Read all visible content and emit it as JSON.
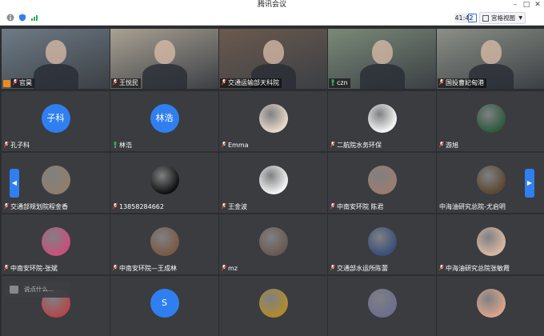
{
  "window": {
    "title": "腾讯会议"
  },
  "toolbar": {
    "timer": "41:42",
    "view_mode": "宫格视图"
  },
  "chat": {
    "placeholder": "说点什么..."
  },
  "participants": [
    {
      "name": "官昊",
      "kind": "video",
      "mic": "muted",
      "bg": "#6e7b86"
    },
    {
      "name": "王悦民",
      "kind": "video",
      "mic": "muted",
      "bg": "#a9a193"
    },
    {
      "name": "交通运输部天科院",
      "kind": "video",
      "mic": "muted",
      "bg": "#6b5a4e"
    },
    {
      "name": "czn",
      "kind": "video",
      "mic": "on",
      "bg": "#7a8a78"
    },
    {
      "name": "国投曹妃甸港",
      "kind": "video",
      "mic": "muted",
      "bg": "#8b8f86"
    },
    {
      "name": "孔子科",
      "kind": "avatar-text",
      "avatar_text": "子科",
      "mic": "muted"
    },
    {
      "name": "林浩",
      "kind": "avatar-text",
      "avatar_text": "林浩",
      "mic": "on"
    },
    {
      "name": "Emma",
      "kind": "avatar-img",
      "mic": "muted",
      "bg": "#e7d9c8"
    },
    {
      "name": "二航院水务环保",
      "kind": "avatar-img",
      "mic": "muted",
      "bg": "#f4f4f4"
    },
    {
      "name": "游旭",
      "kind": "avatar-img",
      "mic": "muted",
      "bg": "#2f5a3e"
    },
    {
      "name": "交通部规划院程金香",
      "kind": "avatar-img",
      "mic": "muted",
      "bg": "#8f7e6a"
    },
    {
      "name": "13858284662",
      "kind": "avatar-img",
      "mic": "muted",
      "bg": "#111111"
    },
    {
      "name": "王金波",
      "kind": "avatar-img",
      "mic": "muted",
      "bg": "#f3f3f3"
    },
    {
      "name": "中南安环院 陈君",
      "kind": "avatar-img",
      "mic": "muted",
      "bg": "#9b7c70"
    },
    {
      "name": "中海油研究总院-尤启明",
      "kind": "avatar-img",
      "mic": "none",
      "bg": "#5b4833"
    },
    {
      "name": "中南安环院-张斌",
      "kind": "avatar-img",
      "mic": "muted",
      "bg": "#c94f7b"
    },
    {
      "name": "中南安环院—王成林",
      "kind": "avatar-img",
      "mic": "muted",
      "bg": "#7a5a44"
    },
    {
      "name": "mz",
      "kind": "avatar-img",
      "mic": "muted",
      "bg": "#6a5a52"
    },
    {
      "name": "交通部水运所陈蕾",
      "kind": "avatar-img",
      "mic": "muted",
      "bg": "#3b4f7a"
    },
    {
      "name": "中海油研究总院张敏霞",
      "kind": "avatar-img",
      "mic": "muted",
      "bg": "#d8b7a2"
    },
    {
      "name": "",
      "kind": "avatar-img",
      "mic": "muted",
      "bg": "#b3484c"
    },
    {
      "name": "",
      "kind": "avatar-text",
      "avatar_text": "S",
      "mic": "muted"
    },
    {
      "name": "",
      "kind": "avatar-img",
      "mic": "muted",
      "bg": "#b08a2e"
    },
    {
      "name": "",
      "kind": "avatar-img",
      "mic": "muted",
      "bg": "#6c6e8f"
    },
    {
      "name": "",
      "kind": "avatar-img",
      "mic": "muted",
      "bg": "#d9a48a"
    }
  ]
}
